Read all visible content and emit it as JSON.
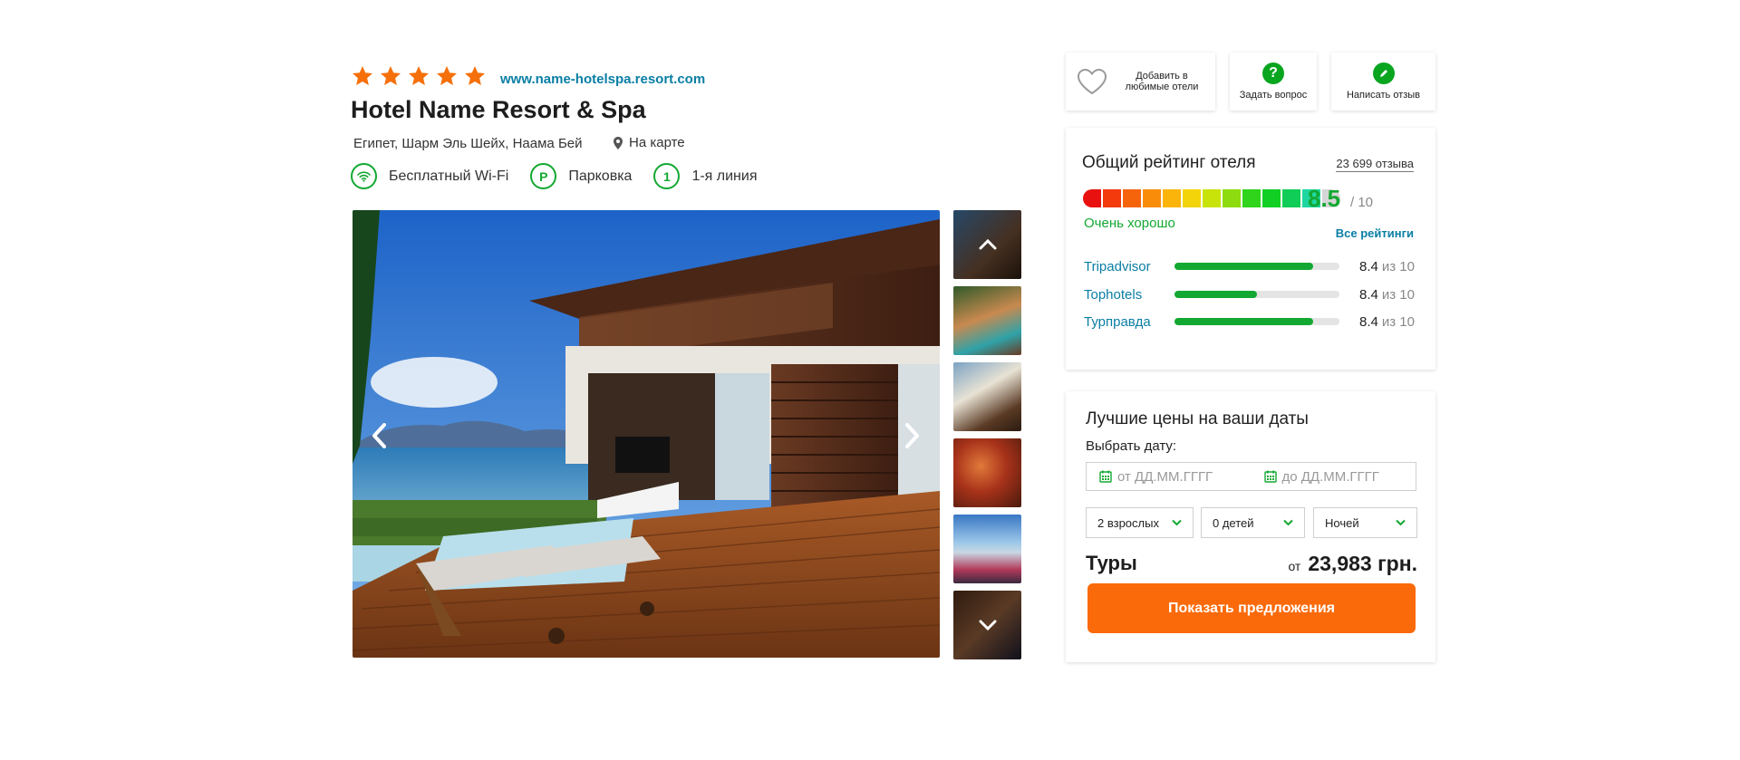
{
  "hotel": {
    "stars": 5,
    "website": "www.name-hotelspa.resort.com",
    "name": "Hotel Name Resort & Spa",
    "location": "Египет, Шарм Эль Шейх, Наама Бей",
    "map_link": "На карте",
    "amenities": [
      {
        "icon": "wifi-icon",
        "label": "Бесплатный Wi-Fi"
      },
      {
        "icon": "parking-icon",
        "glyph": "P",
        "label": "Парковка"
      },
      {
        "icon": "beach-line-icon",
        "glyph": "1",
        "label": "1-я линия"
      }
    ]
  },
  "actions": {
    "favorite": "Добавить в любимые отели",
    "ask": "Задать вопрос",
    "review": "Написать отзыв"
  },
  "rating": {
    "title": "Общий рейтинг отеля",
    "reviews_count": "23 699 отзыва",
    "score": "8.5",
    "out_of": "/ 10",
    "verdict": "Очень хорошо",
    "all_ratings": "Все рейтинги",
    "scale_colors": [
      "#e8110f",
      "#f23a0c",
      "#f5640b",
      "#f98d0a",
      "#fbb40a",
      "#f3d40a",
      "#c8e30a",
      "#8edc0f",
      "#2fd41b",
      "#12cf24",
      "#0fcd57",
      "#1ed7a0",
      "#d6d6d6"
    ],
    "sources": [
      {
        "name": "Tripadvisor",
        "value": "8.4",
        "of": "из 10",
        "fill": 0.84
      },
      {
        "name": "Tophotels",
        "value": "8.4",
        "of": "из 10",
        "fill": 0.5
      },
      {
        "name": "Турправда",
        "value": "8.4",
        "of": "из 10",
        "fill": 0.84
      }
    ]
  },
  "booking": {
    "title": "Лучшие цены на ваши даты",
    "date_label": "Выбрать дату:",
    "date_from_placeholder": "от ДД.ММ.ГГГГ",
    "date_to_placeholder": "до ДД.ММ.ГГГГ",
    "adults": "2 взрослых",
    "children": "0 детей",
    "nights": "Ночей",
    "tours_label": "Туры",
    "price_from": "от",
    "price": "23,983 грн.",
    "cta": "Показать предложения"
  },
  "colors": {
    "accent_orange": "#fa6a0a",
    "rating_green": "#13a832",
    "link_blue": "#0a7ea4",
    "star_orange": "#f5700a"
  }
}
